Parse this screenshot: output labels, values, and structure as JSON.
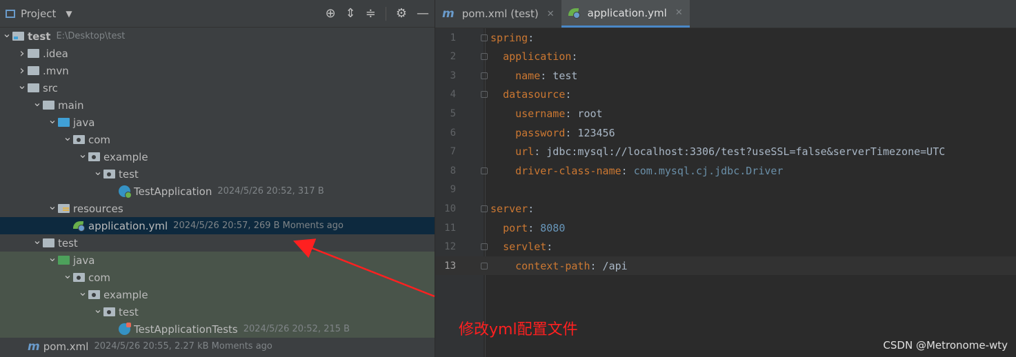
{
  "project_panel": {
    "title": "Project",
    "tree": [
      {
        "depth": 0,
        "arrow": "v",
        "icon": "module",
        "name": "test",
        "bold": true,
        "meta": "E:\\Desktop\\test"
      },
      {
        "depth": 1,
        "arrow": ">",
        "icon": "folder",
        "name": ".idea",
        "meta": ""
      },
      {
        "depth": 1,
        "arrow": ">",
        "icon": "folder",
        "name": ".mvn",
        "meta": ""
      },
      {
        "depth": 1,
        "arrow": "v",
        "icon": "folder",
        "name": "src",
        "meta": ""
      },
      {
        "depth": 2,
        "arrow": "v",
        "icon": "folder",
        "name": "main",
        "meta": ""
      },
      {
        "depth": 3,
        "arrow": "v",
        "icon": "folder-blue",
        "name": "java",
        "meta": ""
      },
      {
        "depth": 4,
        "arrow": "v",
        "icon": "package",
        "name": "com",
        "meta": ""
      },
      {
        "depth": 5,
        "arrow": "v",
        "icon": "package",
        "name": "example",
        "meta": ""
      },
      {
        "depth": 6,
        "arrow": "v",
        "icon": "package",
        "name": "test",
        "meta": ""
      },
      {
        "depth": 7,
        "arrow": "",
        "icon": "spring-class",
        "name": "TestApplication",
        "meta": "2024/5/26 20:52, 317 B"
      },
      {
        "depth": 3,
        "arrow": "v",
        "icon": "resources",
        "name": "resources",
        "meta": ""
      },
      {
        "depth": 4,
        "arrow": "",
        "icon": "spring-yml",
        "name": "application.yml",
        "meta": "2024/5/26 20:57, 269 B Moments ago",
        "selected": true
      },
      {
        "depth": 2,
        "arrow": "v",
        "icon": "folder",
        "name": "test",
        "meta": ""
      },
      {
        "depth": 3,
        "arrow": "v",
        "icon": "folder-green",
        "name": "java",
        "meta": "",
        "testbg": true
      },
      {
        "depth": 4,
        "arrow": "v",
        "icon": "package",
        "name": "com",
        "meta": "",
        "testbg": true
      },
      {
        "depth": 5,
        "arrow": "v",
        "icon": "package",
        "name": "example",
        "meta": "",
        "testbg": true
      },
      {
        "depth": 6,
        "arrow": "v",
        "icon": "package",
        "name": "test",
        "meta": "",
        "testbg": true
      },
      {
        "depth": 7,
        "arrow": "",
        "icon": "test-class",
        "name": "TestApplicationTests",
        "meta": "2024/5/26 20:52, 215 B",
        "testbg": true
      },
      {
        "depth": 1,
        "arrow": "",
        "icon": "maven",
        "name": "pom.xml",
        "meta": "2024/5/26 20:55, 2.27 kB Moments ago"
      }
    ]
  },
  "tabs": [
    {
      "icon": "m",
      "label": "pom.xml (test)",
      "active": false
    },
    {
      "icon": "spring",
      "label": "application.yml",
      "active": true
    }
  ],
  "editor": {
    "current_line": 13,
    "lines": [
      {
        "n": "1",
        "parts": [
          [
            "key",
            "spring"
          ],
          [
            "val",
            ":"
          ]
        ]
      },
      {
        "n": "2",
        "parts": [
          [
            "val",
            "  "
          ],
          [
            "key",
            "application"
          ],
          [
            "val",
            ":"
          ]
        ]
      },
      {
        "n": "3",
        "parts": [
          [
            "val",
            "    "
          ],
          [
            "key",
            "name"
          ],
          [
            "val",
            ": test"
          ]
        ]
      },
      {
        "n": "4",
        "parts": [
          [
            "val",
            "  "
          ],
          [
            "key",
            "datasource"
          ],
          [
            "val",
            ":"
          ]
        ]
      },
      {
        "n": "5",
        "parts": [
          [
            "val",
            "    "
          ],
          [
            "key",
            "username"
          ],
          [
            "val",
            ": root"
          ]
        ]
      },
      {
        "n": "6",
        "parts": [
          [
            "val",
            "    "
          ],
          [
            "key",
            "password"
          ],
          [
            "val",
            ": 123456"
          ]
        ]
      },
      {
        "n": "7",
        "parts": [
          [
            "val",
            "    "
          ],
          [
            "key",
            "url"
          ],
          [
            "val",
            ": jdbc:mysql://localhost:3306/test?useSSL=false&serverTimezone=UTC"
          ]
        ]
      },
      {
        "n": "8",
        "parts": [
          [
            "val",
            "    "
          ],
          [
            "key",
            "driver-class-name"
          ],
          [
            "val",
            ": "
          ],
          [
            "cls",
            "com.mysql.cj.jdbc.Driver"
          ]
        ]
      },
      {
        "n": "9",
        "parts": []
      },
      {
        "n": "10",
        "parts": [
          [
            "key",
            "server"
          ],
          [
            "val",
            ":"
          ]
        ]
      },
      {
        "n": "11",
        "parts": [
          [
            "val",
            "  "
          ],
          [
            "key",
            "port"
          ],
          [
            "val",
            ": "
          ],
          [
            "num",
            "8080"
          ]
        ]
      },
      {
        "n": "12",
        "parts": [
          [
            "val",
            "  "
          ],
          [
            "key",
            "servlet"
          ],
          [
            "val",
            ":"
          ]
        ]
      },
      {
        "n": "13",
        "parts": [
          [
            "val",
            "    "
          ],
          [
            "key",
            "context-path"
          ],
          [
            "val",
            ": /api"
          ]
        ]
      }
    ]
  },
  "annotation": "修改yml配置文件",
  "watermark": "CSDN @Metronome-wty",
  "colors": {
    "selected": "#0d293e",
    "test_bg": "#49544a",
    "arrow": "#ff2020",
    "keyword": "#cc7832"
  }
}
